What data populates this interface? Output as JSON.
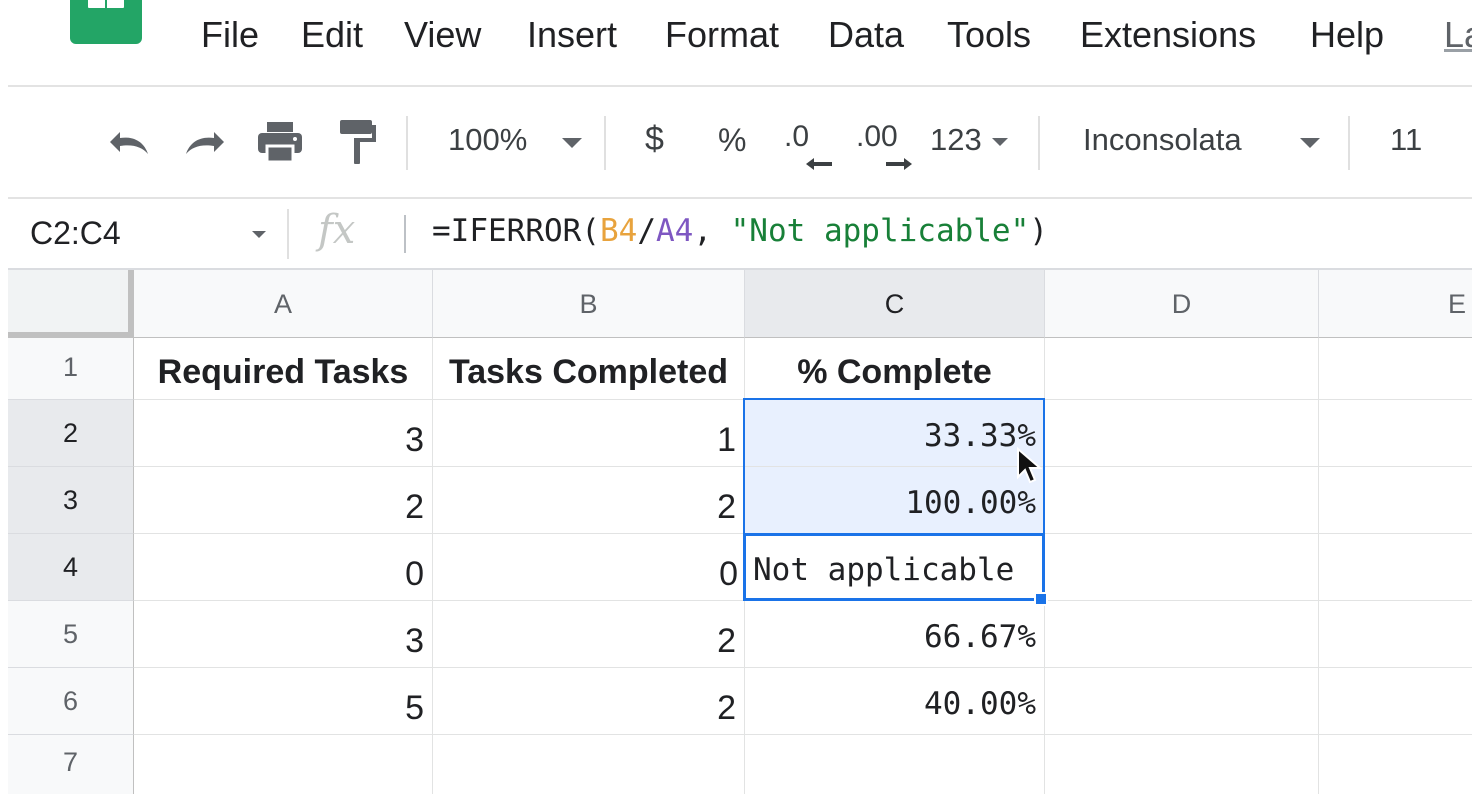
{
  "menu": {
    "items": [
      "File",
      "Edit",
      "View",
      "Insert",
      "Format",
      "Data",
      "Tools",
      "Extensions",
      "Help",
      "La"
    ]
  },
  "toolbar": {
    "icons": [
      "undo-icon",
      "redo-icon",
      "print-icon",
      "paint-format-icon"
    ],
    "zoom": "100%",
    "currency": "$",
    "percent": "%",
    "decrease_decimal": ".0",
    "increase_decimal": ".00",
    "more_formats": "123",
    "font_family": "Inconsolata",
    "font_size": "11"
  },
  "formula_bar": {
    "name_box": "C2:C4",
    "fx": "fx",
    "formula_prefix": "=IFERROR(",
    "formula_ref1": "B4",
    "formula_slash": "/",
    "formula_ref2": "A4",
    "formula_comma": ", ",
    "formula_string": "\"Not applicable\"",
    "formula_suffix": ")"
  },
  "sheet": {
    "columns": [
      "A",
      "B",
      "C",
      "D",
      "E"
    ],
    "rows": [
      "1",
      "2",
      "3",
      "4",
      "5",
      "6",
      "7"
    ],
    "cells": {
      "A1": "Required Tasks",
      "B1": "Tasks Completed",
      "C1": "% Complete",
      "A2": "3",
      "B2": "1",
      "C2": "33.33%",
      "A3": "2",
      "B3": "2",
      "C3": "100.00%",
      "A4": "0",
      "B4": "0",
      "C4": "Not applicable",
      "A5": "3",
      "B5": "2",
      "C5": "66.67%",
      "A6": "5",
      "B6": "2",
      "C6": "40.00%"
    },
    "selection": "C2:C4",
    "active_cell": "C4"
  },
  "colors": {
    "selection_border": "#1a73e8",
    "selection_fill": "#e8f0fe",
    "sheets_green": "#23a566",
    "ref_b_color": "#e8a33d",
    "ref_a_color": "#7e57c2",
    "string_color": "#188038"
  }
}
